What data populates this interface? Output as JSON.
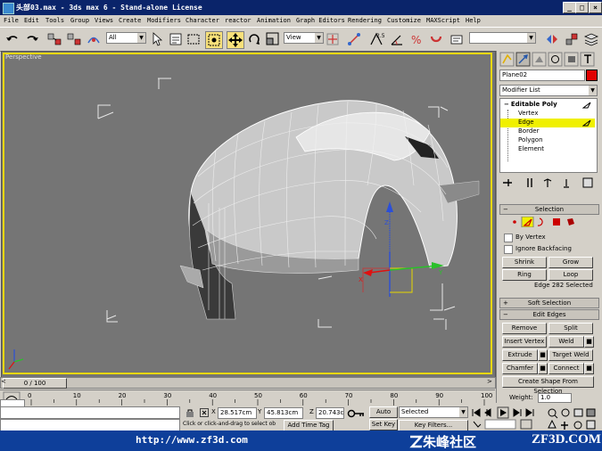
{
  "window": {
    "title": "头部03.max - 3ds max 6 - Stand-alone License",
    "minimize": "_",
    "maximize": "□",
    "close": "×"
  },
  "menu": [
    "File",
    "Edit",
    "Tools",
    "Group",
    "Views",
    "Create",
    "Modifiers",
    "Character",
    "reactor",
    "Animation",
    "Graph Editors",
    "Rendering",
    "Customize",
    "MAXScript",
    "Help"
  ],
  "toolbar": {
    "selection_filter": "All",
    "ref_coord": "View",
    "named_selection": ""
  },
  "viewport": {
    "label": "Perspective",
    "gizmo_axes": [
      "X",
      "Y",
      "Z"
    ]
  },
  "command_panel": {
    "object_name": "Plane02",
    "modifier_list": "Modifier List",
    "stack": {
      "root": "Editable Poly",
      "items": [
        "Vertex",
        "Edge",
        "Border",
        "Polygon",
        "Element"
      ],
      "active": "Edge"
    },
    "selection_rollout": {
      "title": "Selection",
      "by_vertex": "By Vertex",
      "ignore_backfacing": "Ignore Backfacing",
      "shrink": "Shrink",
      "grow": "Grow",
      "ring": "Ring",
      "loop": "Loop",
      "status": "Edge 282 Selected"
    },
    "soft_selection": "Soft Selection",
    "edit_edges": {
      "title": "Edit Edges",
      "remove": "Remove",
      "split": "Split",
      "insert_vertex": "Insert Vertex",
      "weld": "Weld",
      "extrude": "Extrude",
      "target_weld": "Target Weld",
      "chamfer": "Chamfer",
      "connect": "Connect",
      "create_shape": "Create Shape From Selection",
      "weight_label": "Weight:",
      "weight_value": "1.0"
    }
  },
  "time": {
    "slider": "0 / 100",
    "ticks": [
      "0",
      "10",
      "20",
      "30",
      "40",
      "50",
      "60",
      "70",
      "80",
      "90",
      "100"
    ]
  },
  "status": {
    "x_label": "X",
    "x_value": "28.517cm",
    "y_label": "Y",
    "y_value": "45.813cm",
    "z_label": "Z",
    "z_value": "20.743c",
    "prompt": "Click or click-and-drag to select ob",
    "add_time_tag": "Add Time Tag",
    "auto_key": "Auto Key",
    "selected": "Selected",
    "set_key": "Set Key",
    "key_filters": "Key Filters..."
  },
  "watermark": {
    "url": "http://www.zf3d.com",
    "site_cn": "朱峰社区",
    "site_en": "ZF3D.COM"
  },
  "colors": {
    "viewport_bg": "#757575",
    "active_border": "#e8d800",
    "title_bar": "#0a246a",
    "active_stack": "#f0f000"
  }
}
